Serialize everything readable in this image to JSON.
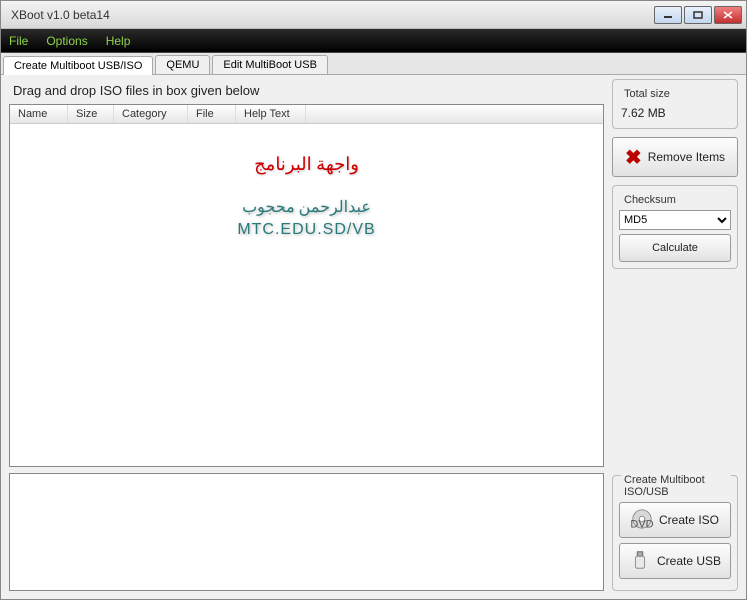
{
  "window": {
    "title": "XBoot v1.0 beta14"
  },
  "menu": {
    "file": "File",
    "options": "Options",
    "help": "Help"
  },
  "tabs": [
    {
      "label": "Create Multiboot USB/ISO"
    },
    {
      "label": "QEMU"
    },
    {
      "label": "Edit MultiBoot USB"
    }
  ],
  "instruction": "Drag and drop ISO files in box given below",
  "columns": {
    "name": "Name",
    "size": "Size",
    "category": "Category",
    "file": "File",
    "help": "Help Text"
  },
  "overlay": {
    "line1": "واجهة البرنامج",
    "line2": "عبدالرحمن محجوب",
    "line3": "MTC.EDU.SD/VB"
  },
  "total": {
    "label": "Total size",
    "value": "7.62 MB"
  },
  "remove_label": "Remove Items",
  "checksum": {
    "label": "Checksum",
    "selected": "MD5",
    "calculate": "Calculate"
  },
  "create": {
    "label": "Create Multiboot ISO/USB",
    "iso": "Create ISO",
    "usb": "Create USB"
  }
}
